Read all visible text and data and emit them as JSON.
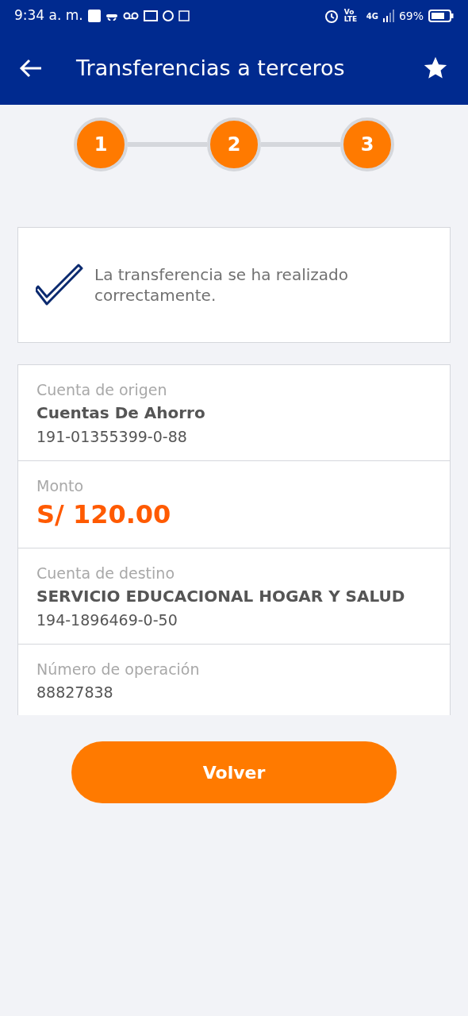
{
  "status_bar": {
    "time": "9:34 a. m.",
    "volte": "Vo LTE",
    "network": "4G",
    "battery": "69%"
  },
  "header": {
    "title": "Transferencias a terceros"
  },
  "steps": [
    {
      "label": "1",
      "done": true
    },
    {
      "label": "2",
      "done": true
    },
    {
      "label": "3",
      "done": true
    }
  ],
  "success_message": "La transferencia se ha realizado correctamente.",
  "details": [
    {
      "kind": "account",
      "label": "Cuenta de origen",
      "name": "Cuentas De Ahorro",
      "number": "191-01355399-0-88"
    },
    {
      "kind": "amount",
      "label": "Monto",
      "value": "S/ 120.00"
    },
    {
      "kind": "account",
      "label": "Cuenta de destino",
      "name": "SERVICIO EDUCACIONAL HOGAR Y SALUD",
      "number": "194-1896469-0-50"
    },
    {
      "kind": "plain",
      "label": "Número de operación",
      "value": "88827838"
    }
  ],
  "button": "Volver"
}
